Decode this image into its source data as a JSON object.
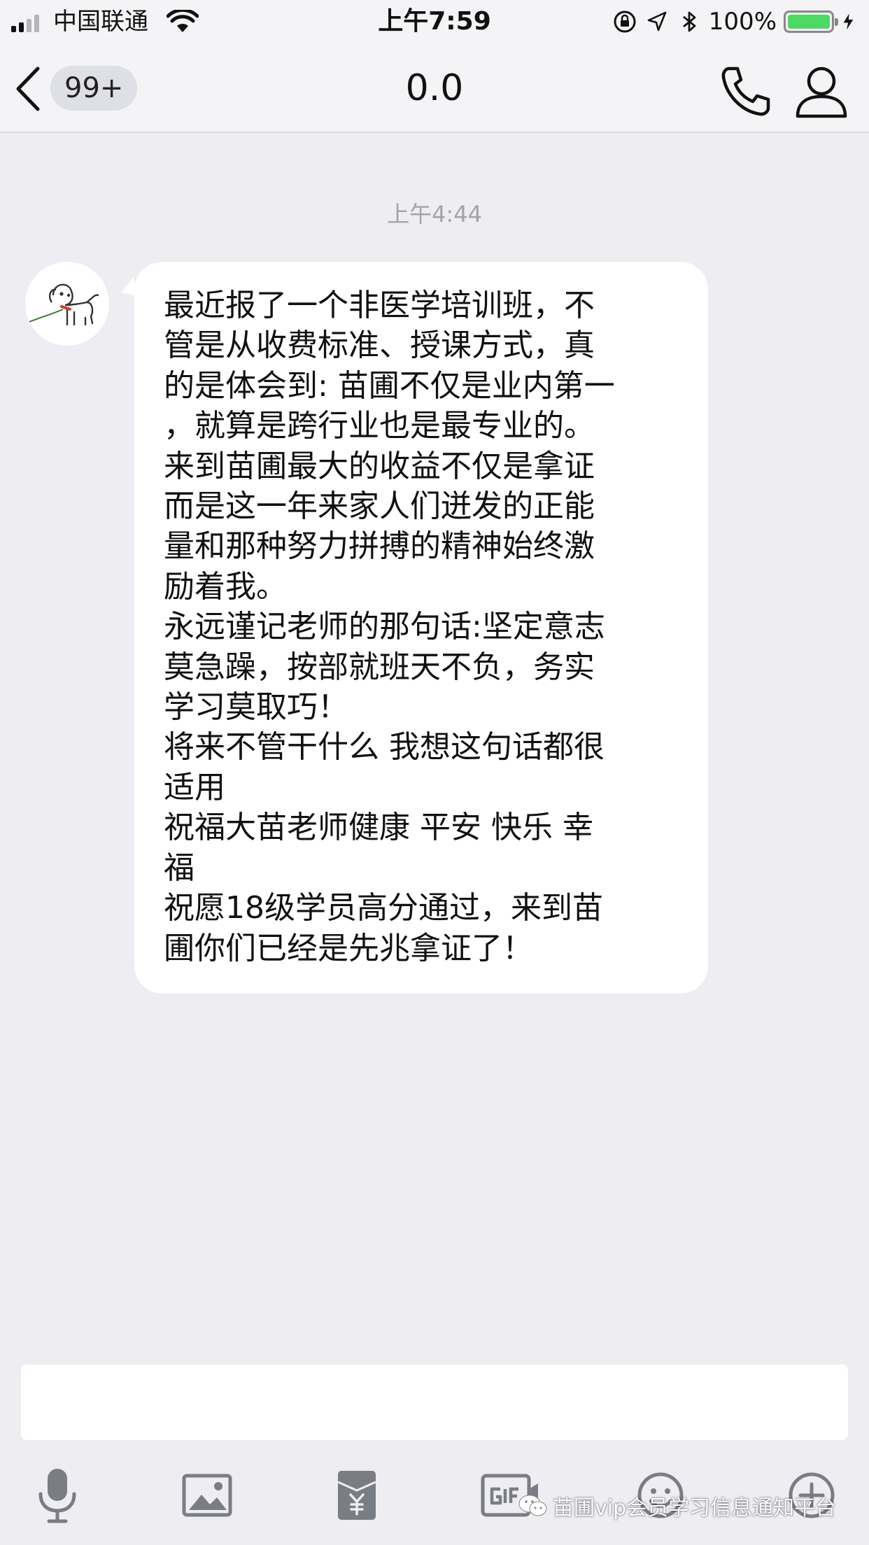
{
  "status_bar": {
    "carrier": "中国联通",
    "time": "上午7:59",
    "battery_percent": "100%",
    "battery_level": 1.0,
    "battery_color": "#4cd964"
  },
  "nav": {
    "back_icon": "chevron-left-icon",
    "unread_badge": "99+",
    "title": "0.0",
    "call_icon": "phone-icon",
    "profile_icon": "person-icon"
  },
  "chat": {
    "timestamp": "上午4:44",
    "message": {
      "sender_avatar": "dog-avatar",
      "lines": [
        "最近报了一个非医学培训班，不",
        "管是从收费标准、授课方式，真",
        "的是体会到: 苗圃不仅是业内第一",
        "，就算是跨行业也是最专业的。",
        "来到苗圃最大的收益不仅是拿证",
        "而是这一年来家人们迸发的正能",
        "量和那种努力拼搏的精神始终激",
        "励着我。",
        "永远谨记老师的那句话:坚定意志",
        "莫急躁，按部就班天不负，务实",
        "学习莫取巧！",
        "将来不管干什么 我想这句话都很",
        "适用",
        "祝福大苗老师健康 平安 快乐 幸",
        "福",
        "祝愿18级学员高分通过，来到苗",
        "圃你们已经是先兆拿证了！"
      ]
    }
  },
  "input_bar": {
    "value": ""
  },
  "toolbar": {
    "items": [
      "microphone-icon",
      "image-icon",
      "red-packet-icon",
      "gif-icon",
      "emoji-icon",
      "plus-icon"
    ]
  },
  "watermark": {
    "text": "苗圃vip会员学习信息通知平台"
  },
  "colors": {
    "background": "#ededf2",
    "bubble": "#ffffff",
    "icon_gray": "#7b7d85"
  }
}
